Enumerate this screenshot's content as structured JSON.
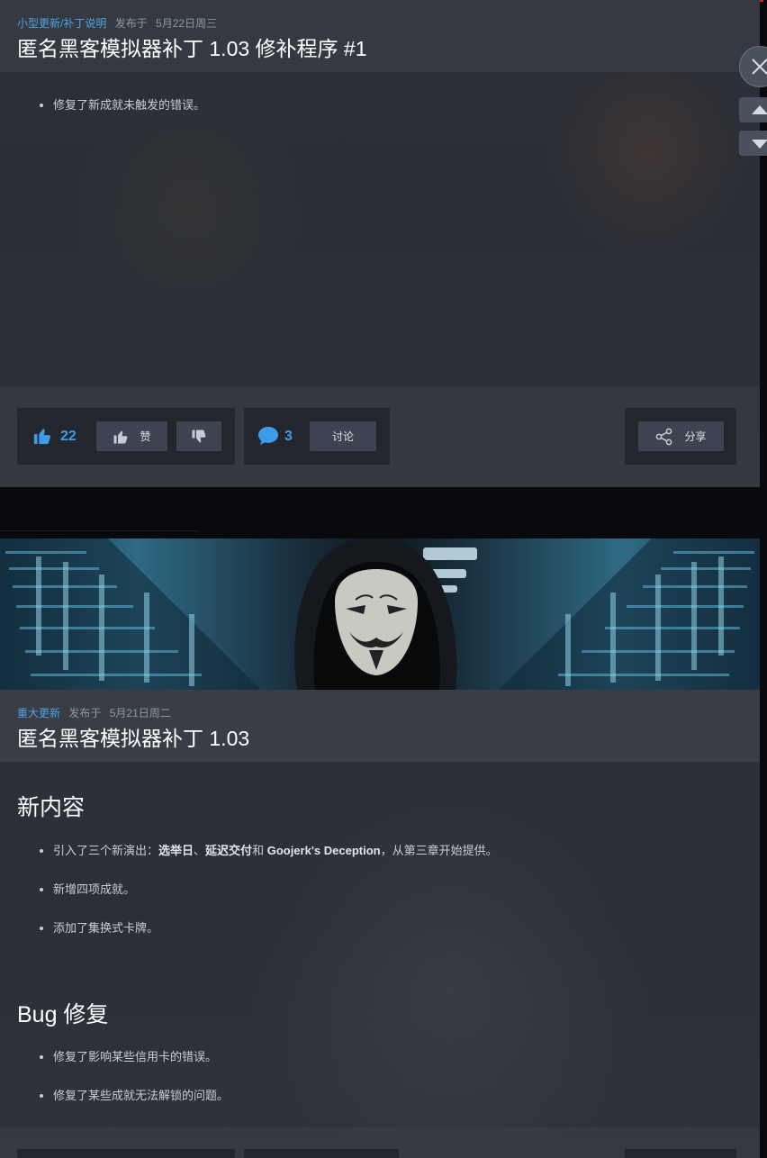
{
  "post1": {
    "category": "小型更新/补丁说明",
    "published_prefix": "发布于",
    "date": "5月22日周三",
    "title": "匿名黑客模拟器补丁 1.03 修补程序 #1",
    "notes": [
      "修复了新成就未触发的错误。"
    ],
    "footer": {
      "likes": "22",
      "like_label": "赞",
      "comments": "3",
      "discuss_label": "讨论",
      "share_label": "分享"
    }
  },
  "post2": {
    "category": "重大更新",
    "published_prefix": "发布于",
    "date": "5月21日周二",
    "title": "匿名黑客模拟器补丁 1.03",
    "sections": [
      {
        "heading": "新内容",
        "items": [
          {
            "prefix": "引入了三个新演出：",
            "b1": "选举日",
            "sep": "、",
            "b2": "延迟交付",
            "mid": "和",
            "b3": "Goojerk's Deception",
            "suffix": "，从第三章开始提供。"
          },
          {
            "text": "新增四项成就。"
          },
          {
            "text": "添加了集换式卡牌。"
          }
        ]
      },
      {
        "heading": "Bug 修复",
        "items": [
          {
            "text": "修复了影响某些信用卡的错误。"
          },
          {
            "text": "修复了某些成就无法解锁的问题。"
          }
        ]
      }
    ]
  },
  "colors": {
    "accent_blue": "#3d9be9",
    "category_blue": "#4fa4e3",
    "title_white": "#ffffff",
    "alert_red": "#c7252e"
  },
  "icons": {
    "like": "thumbs-up-icon",
    "dislike": "thumbs-down-icon",
    "comment": "speech-bubble-icon",
    "share": "share-icon",
    "close": "close-icon",
    "up": "arrow-up-icon",
    "down": "arrow-down-icon"
  }
}
